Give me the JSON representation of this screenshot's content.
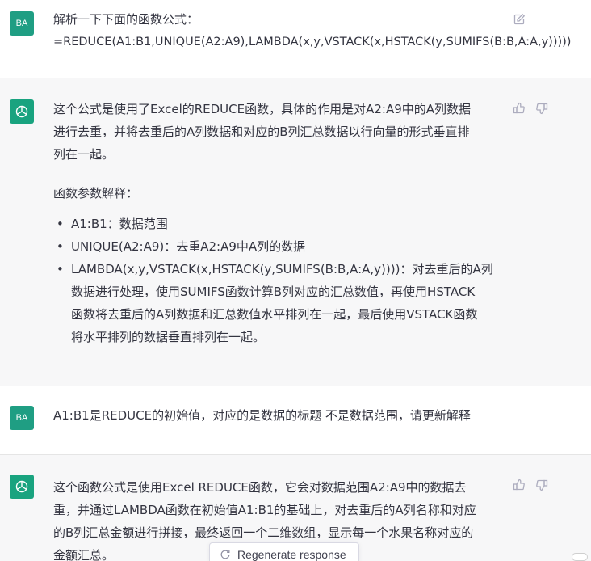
{
  "messages": {
    "m1": {
      "avatar": "BA",
      "line1": "解析一下下面的函数公式：",
      "line2": "=REDUCE(A1:B1,UNIQUE(A2:A9),LAMBDA(x,y,VSTACK(x,HSTACK(y,SUMIFS(B:B,A:A,y)))))"
    },
    "m2": {
      "intro": [
        "这个公式是使用了Excel的REDUCE函数，具体的作用是对A2:A9中的A列数据",
        "进行去重，并将去重后的A列数据和对应的B列汇总数据以行向量的形式垂直排",
        "列在一起。"
      ],
      "params_title": "函数参数解释：",
      "bullets": [
        [
          "A1:B1：数据范围"
        ],
        [
          "UNIQUE(A2:A9)：去重A2:A9中A列的数据"
        ],
        [
          "LAMBDA(x,y,VSTACK(x,HSTACK(y,SUMIFS(B:B,A:A,y))))：对去重后的A列",
          "数据进行处理，使用SUMIFS函数计算B列对应的汇总数值，再使用HSTACK",
          "函数将去重后的A列数据和汇总数值水平排列在一起，最后使用VSTACK函数",
          "将水平排列的数据垂直排列在一起。"
        ]
      ]
    },
    "m3": {
      "avatar": "BA",
      "line1": "A1:B1是REDUCE的初始值，对应的是数据的标题 不是数据范围，请更新解释"
    },
    "m4": {
      "lines": [
        "这个函数公式是使用Excel REDUCE函数，它会对数据范围A2:A9中的数据去",
        "重，并通过LAMBDA函数在初始值A1:B1的基础上，对去重后的A列名称和对应",
        "的B列汇总金额进行拼接，最终返回一个二维数组，显示每一个水果名称对应的",
        "金额汇总。"
      ]
    }
  },
  "regenerate_label": "Regenerate response",
  "colors": {
    "bot_avatar": "#19a37f",
    "user_avatar": "#1f9e83",
    "text": "#343541",
    "assistant_bg": "#f7f7f8"
  },
  "icons": [
    "edit-icon",
    "thumbs-up-icon",
    "thumbs-down-icon",
    "openai-logo-icon",
    "refresh-icon"
  ]
}
